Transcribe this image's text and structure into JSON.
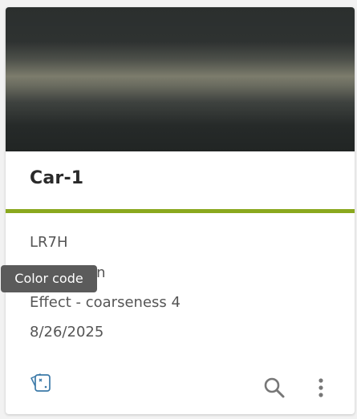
{
  "card": {
    "title": "Car-1",
    "details": {
      "code": "LR7H",
      "color_name": "Green",
      "effect": "Effect - coarseness 4",
      "date": "8/26/2025"
    },
    "tooltip": "Color code",
    "accent_color": "#8aa81e"
  },
  "actions": {
    "swatch": "color-swatch-icon",
    "search": "search-icon",
    "more": "more-vertical-icon"
  }
}
